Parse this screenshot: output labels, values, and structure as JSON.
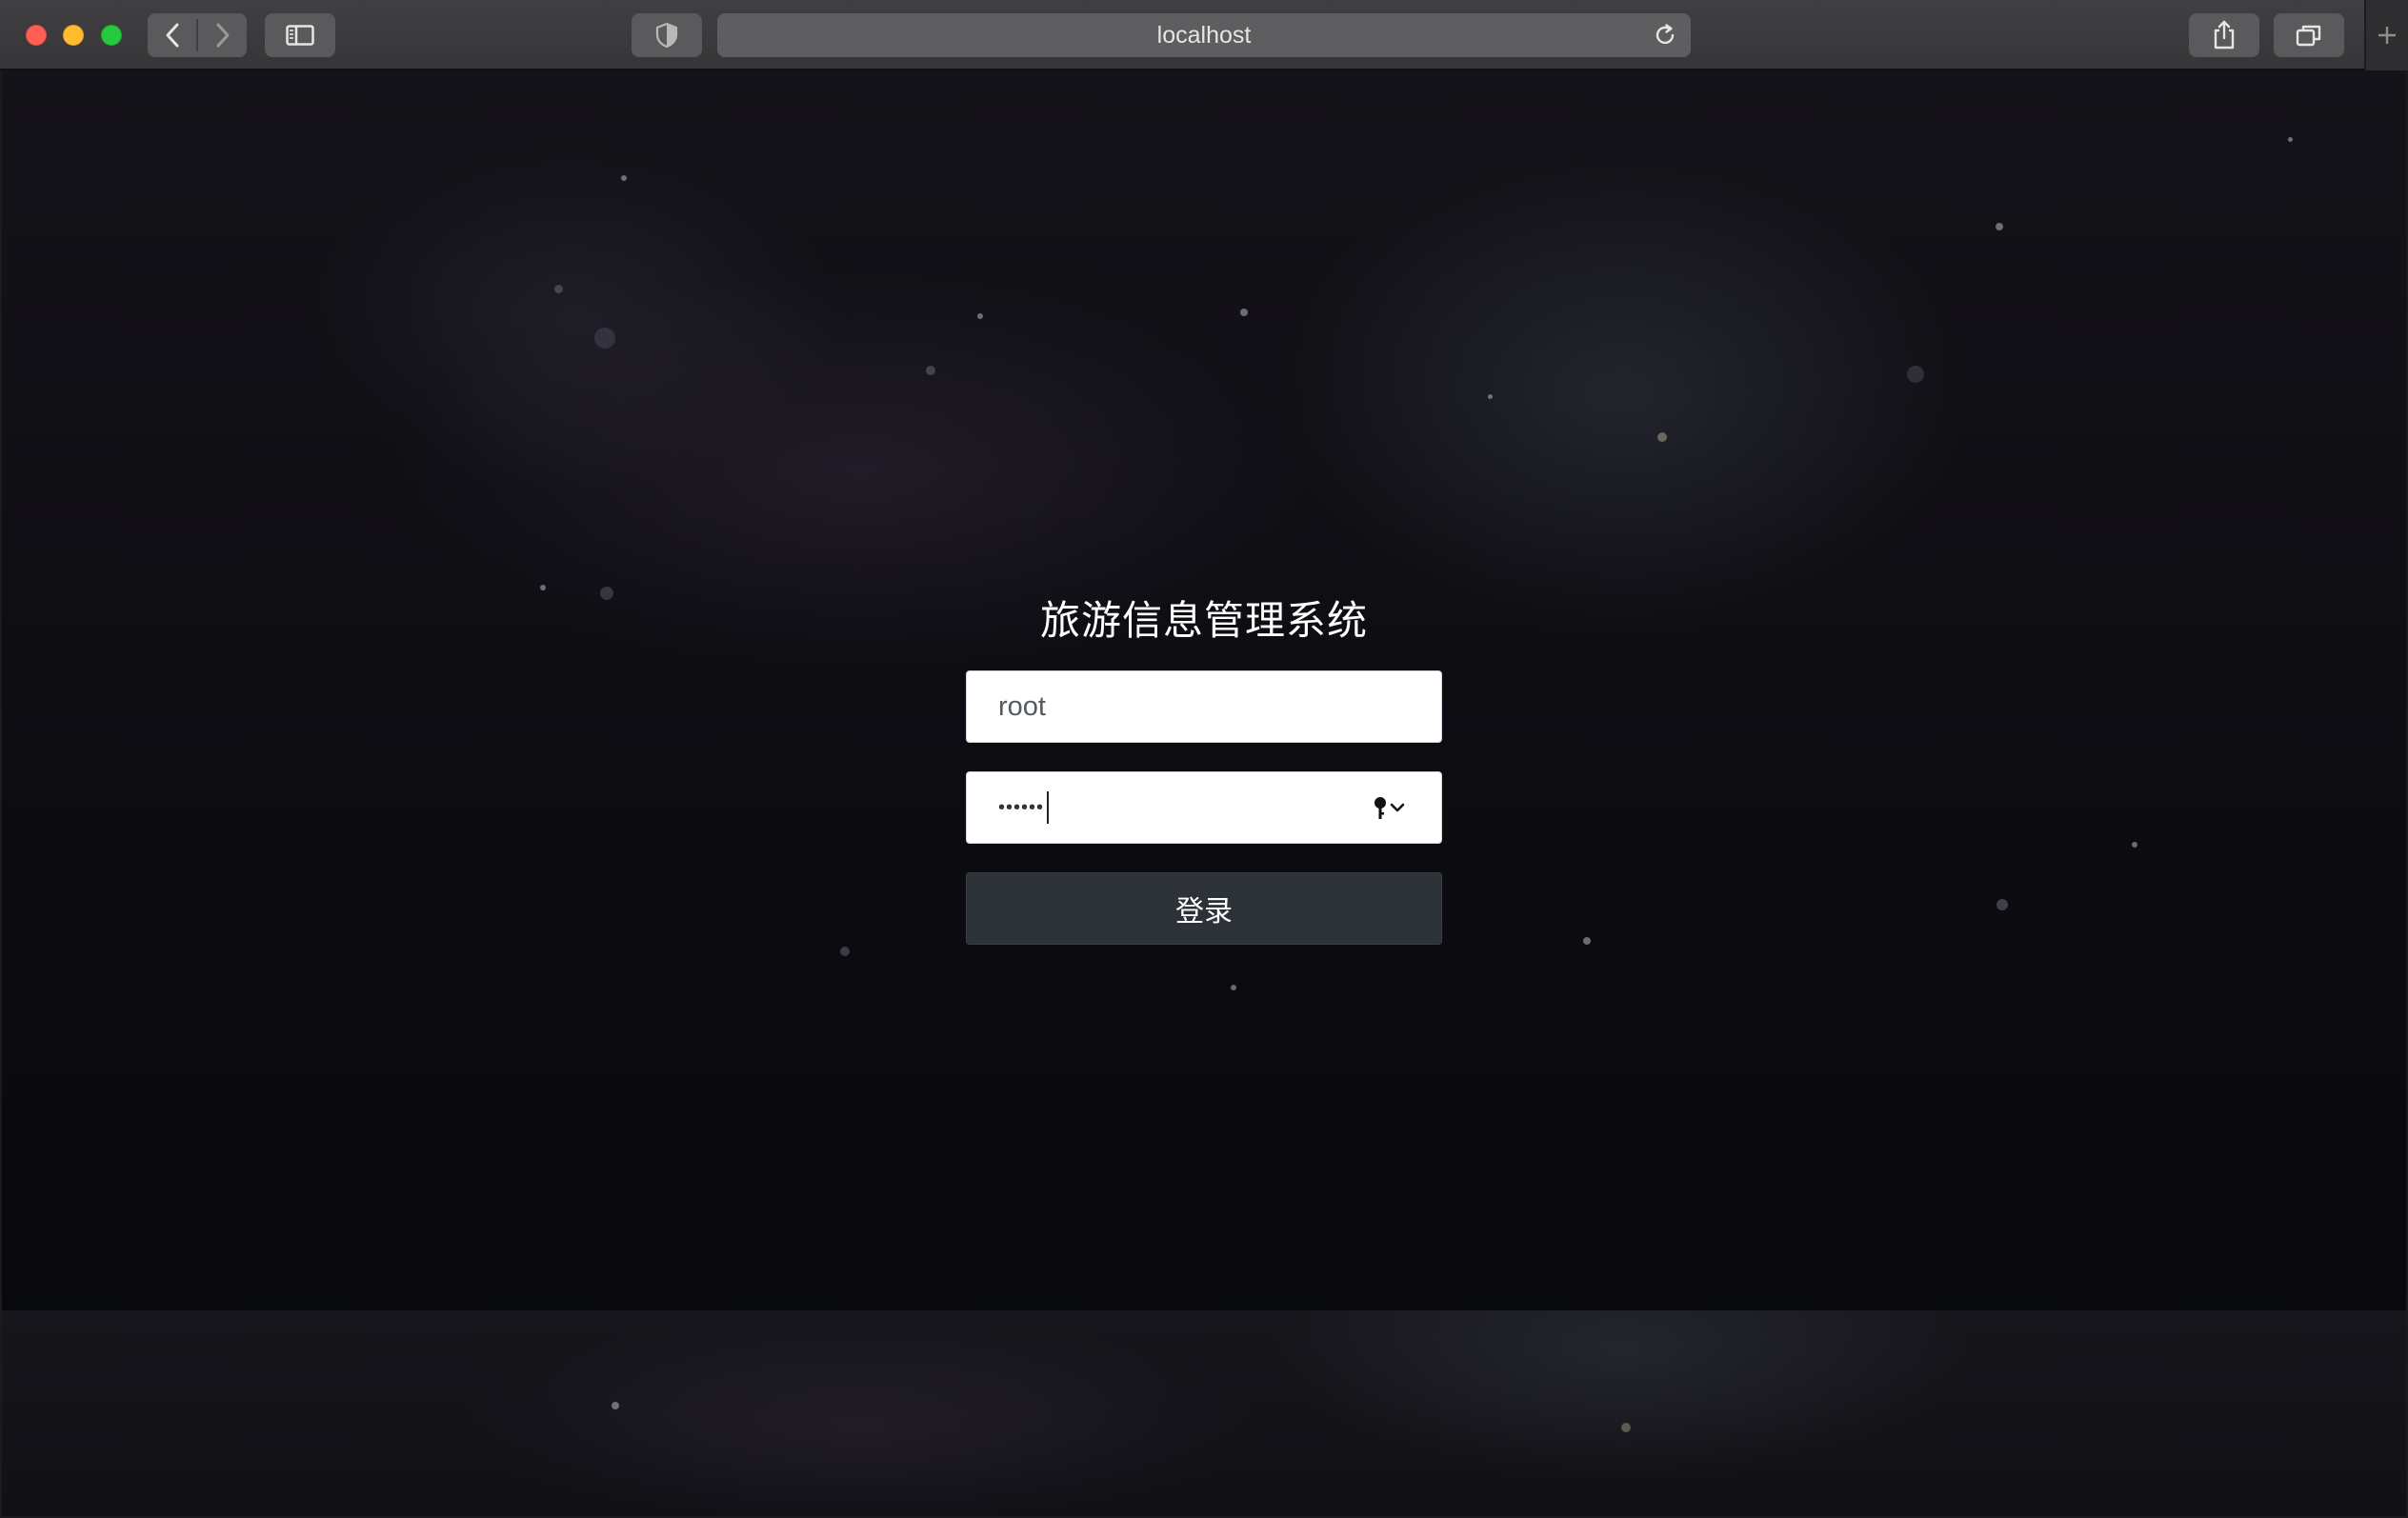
{
  "browser": {
    "url": "localhost",
    "icons": {
      "close": "close-button",
      "minimize": "minimize-button",
      "zoom": "zoom-button",
      "back": "chevron-left-icon",
      "forward": "chevron-right-icon",
      "sidebar": "sidebar-icon",
      "privacy": "shield-icon",
      "reload": "reload-icon",
      "share": "share-icon",
      "tabs": "tab-overview-icon",
      "new_tab": "plus-icon"
    }
  },
  "login": {
    "title": "旅游信息管理系统",
    "username_value": "root",
    "password_masked": "••••••",
    "submit_label": "登录",
    "key_icon": "key-icon"
  },
  "colors": {
    "button_bg": "#2d3239",
    "field_bg": "#ffffff",
    "traffic_red": "#fe5f57",
    "traffic_yellow": "#febc2e",
    "traffic_green": "#28c840"
  }
}
